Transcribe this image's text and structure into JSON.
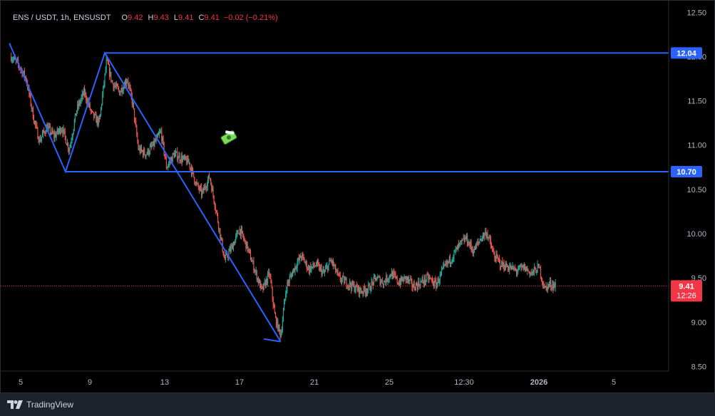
{
  "legend": {
    "symbol": "ENS / USDT, 1h, ENSUSDT",
    "open_key": "O",
    "open": "9.42",
    "high_key": "H",
    "high": "9.43",
    "low_key": "L",
    "low": "9.41",
    "close_key": "C",
    "close": "9.41",
    "change": "−0.02 (−0.21%)"
  },
  "price_tag": {
    "price": "9.41",
    "countdown": "12:26"
  },
  "branding": {
    "name": "TradingView"
  },
  "chart_data": {
    "type": "candlestick",
    "symbol": "ENSUSDT",
    "interval": "1h",
    "y_ticks": [
      8.5,
      9.0,
      9.5,
      10.0,
      10.5,
      11.0,
      11.5,
      12.0,
      12.5
    ],
    "y_tick_labels": [
      "8.50",
      "9.00",
      "9.50",
      "10.00",
      "10.50",
      "11.00",
      "11.50",
      "12.00",
      "12.50"
    ],
    "ylim": [
      8.45,
      12.6
    ],
    "xlim": [
      4.7,
      39.5
    ],
    "x_ticks": [
      5,
      9,
      13,
      17,
      21,
      25,
      29,
      33,
      37
    ],
    "x_tick_labels": [
      "5",
      "9",
      "13",
      "17",
      "21",
      "25",
      "12:30",
      "2026",
      "5"
    ],
    "x_unit": "day (Dec 2025 = 1–31, 32+ = Jan 2026)",
    "grid": false,
    "horizontal_levels": [
      {
        "label": "12.04",
        "value": 12.04,
        "x_start": 9.8,
        "color": "#2962ff"
      },
      {
        "label": "10.70",
        "value": 10.7,
        "x_start": 7.7,
        "color": "#2962ff"
      }
    ],
    "trendlines": [
      {
        "points": [
          [
            4.7,
            12.15
          ],
          [
            7.7,
            10.7
          ],
          [
            9.8,
            12.04
          ],
          [
            19.2,
            8.78
          ]
        ],
        "color": "#2962ff"
      },
      {
        "points": [
          [
            19.2,
            8.78
          ],
          [
            18.3,
            8.81
          ]
        ],
        "color": "#2962ff"
      }
    ],
    "current_price": 9.41,
    "close_path": [
      [
        4.8,
        12.0
      ],
      [
        5.2,
        11.9
      ],
      [
        5.6,
        11.75
      ],
      [
        6.0,
        11.3
      ],
      [
        6.3,
        11.05
      ],
      [
        6.7,
        11.2
      ],
      [
        7.1,
        11.1
      ],
      [
        7.5,
        11.2
      ],
      [
        7.9,
        10.95
      ],
      [
        8.3,
        11.4
      ],
      [
        8.7,
        11.6
      ],
      [
        9.1,
        11.35
      ],
      [
        9.5,
        11.25
      ],
      [
        9.9,
        11.95
      ],
      [
        10.2,
        11.7
      ],
      [
        10.6,
        11.6
      ],
      [
        11.0,
        11.75
      ],
      [
        11.3,
        11.45
      ],
      [
        11.6,
        10.95
      ],
      [
        12.0,
        10.9
      ],
      [
        12.4,
        11.0
      ],
      [
        12.8,
        11.15
      ],
      [
        13.1,
        10.75
      ],
      [
        13.5,
        10.9
      ],
      [
        13.9,
        10.85
      ],
      [
        14.3,
        10.8
      ],
      [
        14.7,
        10.55
      ],
      [
        15.0,
        10.45
      ],
      [
        15.4,
        10.65
      ],
      [
        15.8,
        10.2
      ],
      [
        16.2,
        9.7
      ],
      [
        16.6,
        9.85
      ],
      [
        17.0,
        10.05
      ],
      [
        17.4,
        9.85
      ],
      [
        17.8,
        9.6
      ],
      [
        18.2,
        9.35
      ],
      [
        18.6,
        9.55
      ],
      [
        18.9,
        9.05
      ],
      [
        19.2,
        8.85
      ],
      [
        19.5,
        9.4
      ],
      [
        19.9,
        9.6
      ],
      [
        20.3,
        9.75
      ],
      [
        20.7,
        9.6
      ],
      [
        21.1,
        9.65
      ],
      [
        21.5,
        9.55
      ],
      [
        21.9,
        9.7
      ],
      [
        22.3,
        9.5
      ],
      [
        22.7,
        9.45
      ],
      [
        23.1,
        9.4
      ],
      [
        23.5,
        9.35
      ],
      [
        23.9,
        9.38
      ],
      [
        24.3,
        9.5
      ],
      [
        24.7,
        9.45
      ],
      [
        25.1,
        9.55
      ],
      [
        25.5,
        9.45
      ],
      [
        25.9,
        9.5
      ],
      [
        26.3,
        9.4
      ],
      [
        26.7,
        9.45
      ],
      [
        27.1,
        9.5
      ],
      [
        27.5,
        9.42
      ],
      [
        27.9,
        9.6
      ],
      [
        28.3,
        9.72
      ],
      [
        28.7,
        9.85
      ],
      [
        29.1,
        9.95
      ],
      [
        29.5,
        9.8
      ],
      [
        29.9,
        9.95
      ],
      [
        30.2,
        10.02
      ],
      [
        30.6,
        9.75
      ],
      [
        31.0,
        9.65
      ],
      [
        31.4,
        9.62
      ],
      [
        31.8,
        9.58
      ],
      [
        32.2,
        9.62
      ],
      [
        32.6,
        9.55
      ],
      [
        33.0,
        9.62
      ],
      [
        33.3,
        9.38
      ],
      [
        33.6,
        9.43
      ],
      [
        33.9,
        9.41
      ]
    ]
  },
  "colors": {
    "up": "#26a69a",
    "down": "#ef5350",
    "level": "#2962ff",
    "current": "#f23645",
    "background": "#000000",
    "axis_text": "#b2b5be"
  }
}
